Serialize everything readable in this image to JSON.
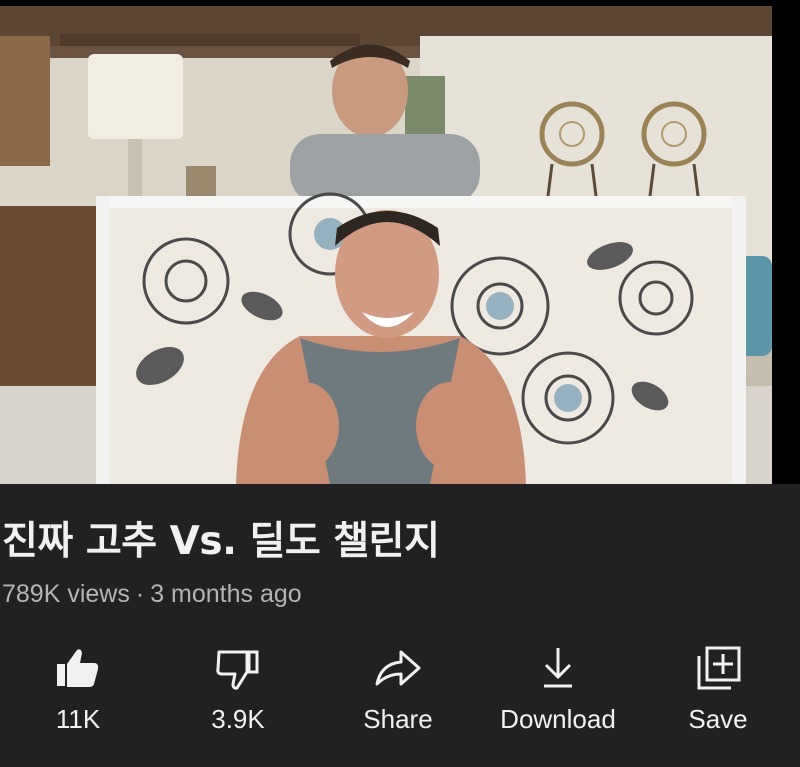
{
  "video": {
    "title": "진짜 고추 Vs. 딜도 챌린지",
    "views": "789K views",
    "separator": "·",
    "age": "3 months ago"
  },
  "actions": {
    "like": {
      "label": "11K",
      "icon": "thumbs-up-icon"
    },
    "dislike": {
      "label": "3.9K",
      "icon": "thumbs-down-icon"
    },
    "share": {
      "label": "Share",
      "icon": "share-icon"
    },
    "download": {
      "label": "Download",
      "icon": "download-icon"
    },
    "save": {
      "label": "Save",
      "icon": "playlist-add-icon"
    }
  },
  "colors": {
    "panel_background": "#212121",
    "primary_text": "#f1f1f1",
    "secondary_text": "#b4b4b4"
  }
}
